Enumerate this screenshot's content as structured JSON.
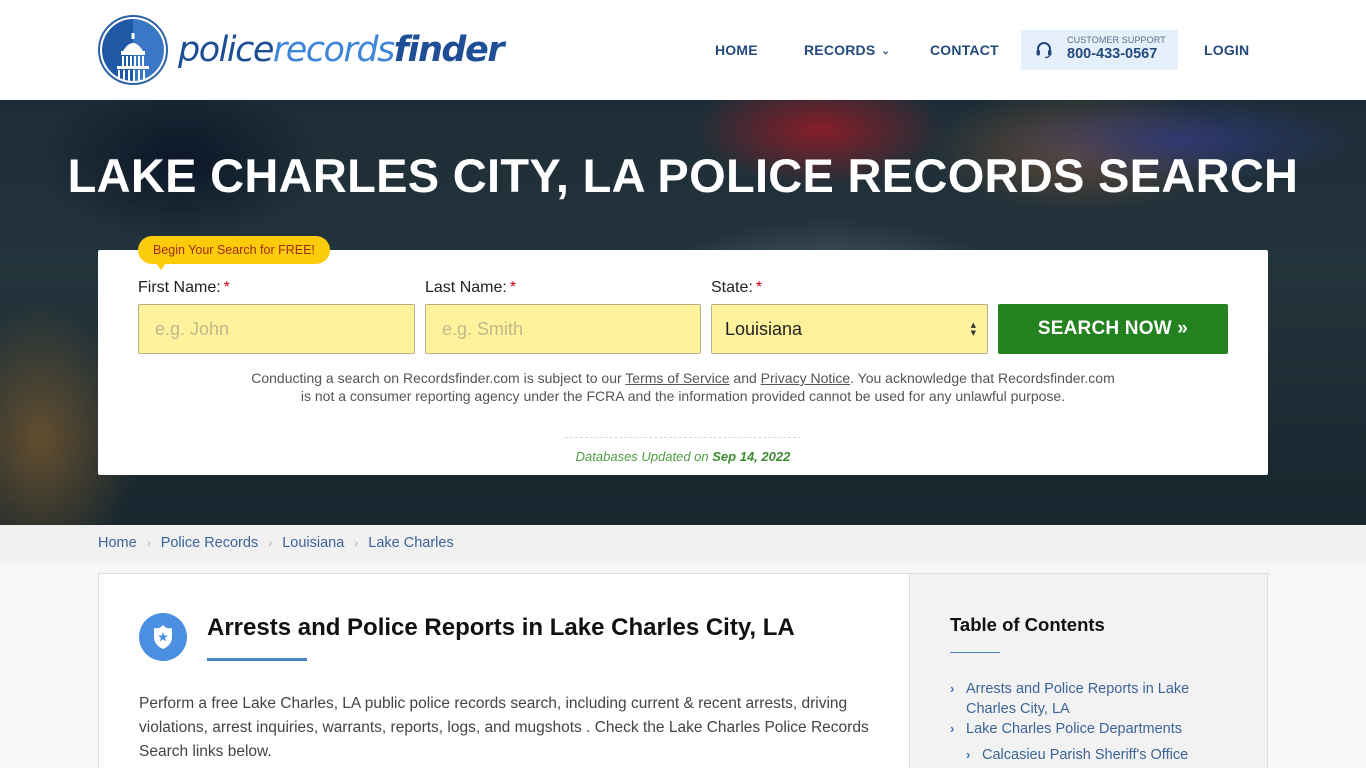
{
  "header": {
    "logo": {
      "part1": "police",
      "part2": "records",
      "part3": "finder",
      "icon": "capitol-dome-icon"
    },
    "nav": {
      "home": "HOME",
      "records": "RECORDS",
      "records_chevron": "⌄",
      "contact": "CONTACT",
      "support_label": "CUSTOMER SUPPORT",
      "support_phone": "800-433-0567",
      "support_icon": "headset-icon",
      "login": "LOGIN"
    }
  },
  "hero": {
    "title": "LAKE CHARLES CITY, LA POLICE RECORDS SEARCH",
    "badge": "Begin Your Search for FREE!",
    "form": {
      "first_name_label": "First Name:",
      "first_name_placeholder": "e.g. John",
      "first_name_value": "",
      "last_name_label": "Last Name:",
      "last_name_placeholder": "e.g. Smith",
      "last_name_value": "",
      "state_label": "State:",
      "state_value": "Louisiana",
      "required_mark": "*",
      "search_button": "SEARCH NOW »"
    },
    "disclaimer": {
      "part1": "Conducting a search on Recordsfinder.com is subject to our ",
      "terms_link": "Terms of Service",
      "part2": " and ",
      "privacy_link": "Privacy Notice",
      "part3": ". You acknowledge that Recordsfinder.com is not a consumer reporting agency under the FCRA and the information provided cannot be used for any unlawful purpose."
    },
    "db_updated_label": "Databases Updated on ",
    "db_updated_date": "Sep 14, 2022"
  },
  "breadcrumb": {
    "separator": "›",
    "items": [
      "Home",
      "Police Records",
      "Louisiana",
      "Lake Charles"
    ]
  },
  "main": {
    "icon": "police-badge-icon",
    "title": "Arrests and Police Reports in Lake Charles City, LA",
    "intro": "Perform a free Lake Charles, LA public police records search, including current & recent arrests, driving violations, arrest inquiries, warrants, reports, logs, and mugshots . Check the Lake Charles Police Records Search links below."
  },
  "sidebar": {
    "toc_title": "Table of Contents",
    "items": [
      "Arrests and Police Reports in Lake Charles City, LA",
      "Lake Charles Police Departments"
    ],
    "sub_items": [
      "Calcasieu Parish Sheriff's Office"
    ]
  }
}
